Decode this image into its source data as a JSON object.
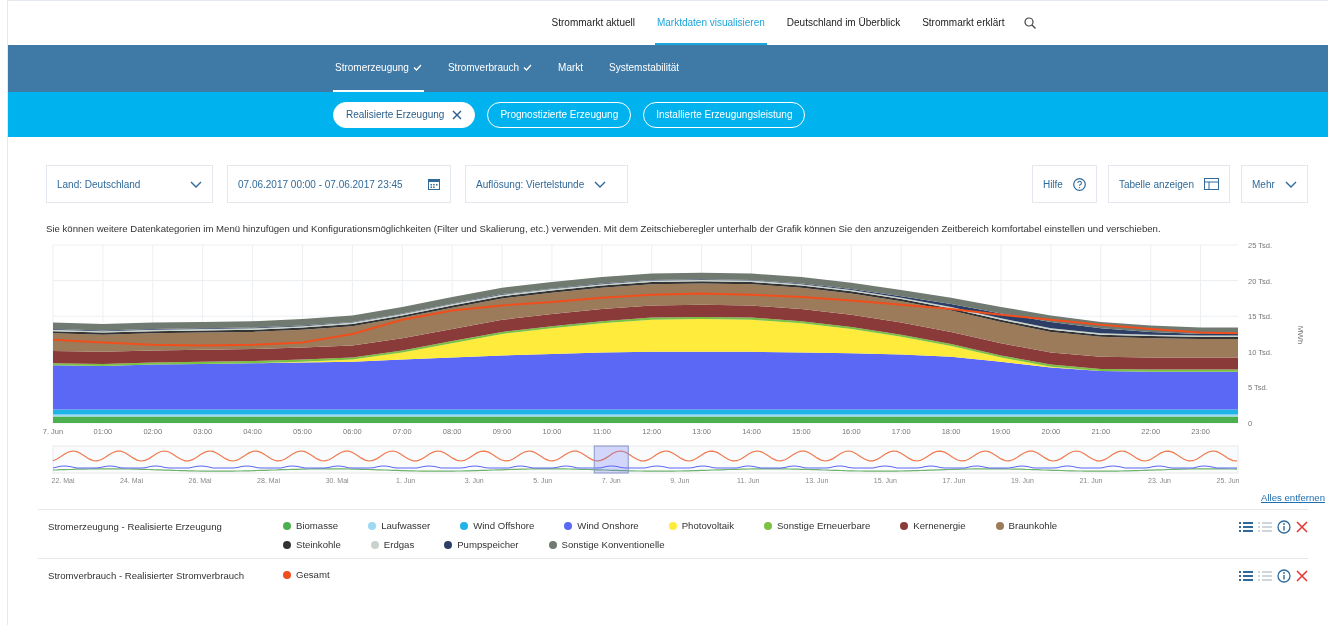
{
  "top_nav": {
    "items": [
      {
        "label": "Strommarkt aktuell",
        "selected": false
      },
      {
        "label": "Marktdaten visualisieren",
        "selected": true
      },
      {
        "label": "Deutschland im Überblick",
        "selected": false
      },
      {
        "label": "Strommarkt erklärt",
        "selected": false
      }
    ]
  },
  "sub_nav": {
    "items": [
      {
        "label": "Stromerzeugung",
        "selected": true,
        "checked": true
      },
      {
        "label": "Stromverbrauch",
        "selected": false,
        "checked": true
      },
      {
        "label": "Markt",
        "selected": false,
        "checked": false
      },
      {
        "label": "Systemstabilität",
        "selected": false,
        "checked": false
      }
    ]
  },
  "filters": [
    {
      "label": "Realisierte Erzeugung",
      "selected": true
    },
    {
      "label": "Prognostizierte Erzeugung",
      "selected": false
    },
    {
      "label": "Installierte Erzeugungsleistung",
      "selected": false
    }
  ],
  "controls": {
    "country": "Land: Deutschland",
    "date_range": "07.06.2017 00:00 - 07.06.2017 23:45",
    "resolution": "Auflösung: Viertelstunde",
    "help": "Hilfe",
    "table": "Tabelle anzeigen",
    "more": "Mehr"
  },
  "info_text": "Sie können weitere Datenkategorien im Menü hinzufügen und Konfigurationsmöglichkeiten (Filter und Skalierung, etc.) verwenden. Mit dem Zeitschieberegler unterhalb der Grafik können Sie den anzuzeigenden Zeitbereich komfortabel einstellen und verschieben.",
  "chart": {
    "chart_data": {
      "type": "area",
      "stacked": true,
      "ylabel": "MWh",
      "x": [
        0,
        1,
        2,
        3,
        4,
        5,
        6,
        7,
        8,
        9,
        10,
        11,
        12,
        13,
        14,
        15,
        16,
        17,
        18,
        19,
        20,
        21,
        22,
        23,
        23.75
      ],
      "xticks": [
        {
          "value": 0,
          "label": "7. Jun"
        },
        {
          "value": 1,
          "label": "01:00"
        },
        {
          "value": 2,
          "label": "02:00"
        },
        {
          "value": 3,
          "label": "03:00"
        },
        {
          "value": 4,
          "label": "04:00"
        },
        {
          "value": 5,
          "label": "05:00"
        },
        {
          "value": 6,
          "label": "06:00"
        },
        {
          "value": 7,
          "label": "07:00"
        },
        {
          "value": 8,
          "label": "08:00"
        },
        {
          "value": 9,
          "label": "09:00"
        },
        {
          "value": 10,
          "label": "10:00"
        },
        {
          "value": 11,
          "label": "11:00"
        },
        {
          "value": 12,
          "label": "12:00"
        },
        {
          "value": 13,
          "label": "13:00"
        },
        {
          "value": 14,
          "label": "14:00"
        },
        {
          "value": 15,
          "label": "15:00"
        },
        {
          "value": 16,
          "label": "16:00"
        },
        {
          "value": 17,
          "label": "17:00"
        },
        {
          "value": 18,
          "label": "18:00"
        },
        {
          "value": 19,
          "label": "19:00"
        },
        {
          "value": 20,
          "label": "20:00"
        },
        {
          "value": 21,
          "label": "21:00"
        },
        {
          "value": 22,
          "label": "22:00"
        },
        {
          "value": 23,
          "label": "23:00"
        }
      ],
      "grid": true,
      "xlim": [
        0,
        23.75
      ],
      "ylim": [
        0,
        25
      ],
      "yticks": [
        {
          "value": 0,
          "label": "0"
        },
        {
          "value": 5,
          "label": "5 Tsd."
        },
        {
          "value": 10,
          "label": "10 Tsd."
        },
        {
          "value": 15,
          "label": "15 Tsd."
        },
        {
          "value": 20,
          "label": "20 Tsd."
        },
        {
          "value": 25,
          "label": "25 Tsd."
        }
      ],
      "series": [
        {
          "name": "Biomasse",
          "color": "#4caf50",
          "values": [
            0.9,
            0.9,
            0.9,
            0.9,
            0.9,
            0.9,
            0.9,
            0.9,
            0.9,
            0.9,
            0.9,
            0.9,
            0.9,
            0.9,
            0.9,
            0.9,
            0.9,
            0.9,
            0.9,
            0.9,
            0.9,
            0.9,
            0.9,
            0.9,
            0.9
          ]
        },
        {
          "name": "Laufwasser",
          "color": "#9dd9f3",
          "values": [
            0.3,
            0.3,
            0.3,
            0.3,
            0.3,
            0.3,
            0.3,
            0.3,
            0.3,
            0.3,
            0.3,
            0.3,
            0.3,
            0.3,
            0.3,
            0.3,
            0.3,
            0.3,
            0.3,
            0.3,
            0.3,
            0.3,
            0.3,
            0.3,
            0.3
          ]
        },
        {
          "name": "Wind Offshore",
          "color": "#1fb4e6",
          "values": [
            0.7,
            0.7,
            0.7,
            0.7,
            0.7,
            0.7,
            0.7,
            0.7,
            0.7,
            0.7,
            0.7,
            0.7,
            0.7,
            0.7,
            0.7,
            0.7,
            0.7,
            0.7,
            0.7,
            0.7,
            0.7,
            0.7,
            0.7,
            0.7,
            0.7
          ]
        },
        {
          "name": "Wind Onshore",
          "color": "#5b67f5",
          "values": [
            6.2,
            6.1,
            6.3,
            6.4,
            6.5,
            6.6,
            6.7,
            7.0,
            7.3,
            7.6,
            7.8,
            8.0,
            8.1,
            8.1,
            8.1,
            8.0,
            7.9,
            7.7,
            7.4,
            6.7,
            5.9,
            5.4,
            5.3,
            5.3,
            5.3
          ]
        },
        {
          "name": "Photovoltaik",
          "color": "#ffeb3b",
          "values": [
            0,
            0,
            0,
            0,
            0,
            0.1,
            0.3,
            1.0,
            2.0,
            3.0,
            3.6,
            4.1,
            4.5,
            4.6,
            4.5,
            4.1,
            3.4,
            2.5,
            1.5,
            0.6,
            0.1,
            0,
            0,
            0,
            0
          ]
        },
        {
          "name": "Sonstige Erneuerbare",
          "color": "#7cc242",
          "values": [
            0.3,
            0.3,
            0.3,
            0.3,
            0.3,
            0.3,
            0.3,
            0.3,
            0.3,
            0.3,
            0.3,
            0.3,
            0.3,
            0.3,
            0.3,
            0.3,
            0.3,
            0.3,
            0.3,
            0.3,
            0.3,
            0.3,
            0.3,
            0.3,
            0.3
          ]
        },
        {
          "name": "Kernenergie",
          "color": "#8b3a3a",
          "values": [
            1.7,
            1.7,
            1.7,
            1.7,
            1.7,
            1.7,
            1.7,
            1.7,
            1.7,
            1.7,
            1.7,
            1.7,
            1.7,
            1.7,
            1.7,
            1.7,
            1.7,
            1.7,
            1.7,
            1.7,
            1.7,
            1.7,
            1.7,
            1.7,
            1.7
          ]
        },
        {
          "name": "Braunkohle",
          "color": "#9c7b5a",
          "values": [
            2.5,
            2.4,
            2.4,
            2.4,
            2.4,
            2.5,
            2.7,
            2.9,
            3.0,
            3.0,
            3.0,
            3.0,
            3.0,
            3.0,
            3.0,
            3.0,
            3.0,
            3.0,
            3.0,
            3.0,
            2.9,
            2.8,
            2.7,
            2.6,
            2.6
          ]
        },
        {
          "name": "Steinkohle",
          "color": "#333333",
          "values": [
            0.3,
            0.3,
            0.3,
            0.3,
            0.3,
            0.3,
            0.3,
            0.3,
            0.3,
            0.3,
            0.3,
            0.3,
            0.3,
            0.3,
            0.3,
            0.3,
            0.3,
            0.3,
            0.3,
            0.3,
            0.3,
            0.3,
            0.3,
            0.3,
            0.3
          ]
        },
        {
          "name": "Erdgas",
          "color": "#c9d3cc",
          "values": [
            0.2,
            0.2,
            0.2,
            0.2,
            0.2,
            0.2,
            0.2,
            0.2,
            0.2,
            0.2,
            0.2,
            0.2,
            0.2,
            0.2,
            0.2,
            0.2,
            0.2,
            0.2,
            0.2,
            0.2,
            0.2,
            0.2,
            0.2,
            0.2,
            0.2
          ]
        },
        {
          "name": "Pumpspeicher",
          "color": "#2c3e66",
          "values": [
            0.1,
            0.1,
            0.1,
            0.1,
            0.1,
            0.1,
            0.1,
            0.1,
            0.1,
            0.1,
            0.1,
            0.1,
            0.1,
            0.1,
            0.1,
            0.1,
            0.1,
            0.2,
            0.4,
            0.7,
            0.9,
            0.7,
            0.4,
            0.2,
            0.2
          ]
        },
        {
          "name": "Sonstige Konventionelle",
          "color": "#707a70",
          "values": [
            0.9,
            0.9,
            0.9,
            0.9,
            0.9,
            0.9,
            0.9,
            0.9,
            0.9,
            0.9,
            0.9,
            0.9,
            0.9,
            0.9,
            0.9,
            0.9,
            0.9,
            0.9,
            0.9,
            0.9,
            0.9,
            0.9,
            0.9,
            0.9,
            0.9
          ]
        },
        {
          "name": "Gesamt",
          "type": "line",
          "color": "#f04e1c",
          "values": [
            11.7,
            11.3,
            11.0,
            10.9,
            11.0,
            11.3,
            12.5,
            14.5,
            15.8,
            16.5,
            17.0,
            17.6,
            18.0,
            18.2,
            18.0,
            17.7,
            17.2,
            16.6,
            16.0,
            15.2,
            14.5,
            13.8,
            13.2,
            12.7,
            12.6
          ]
        }
      ]
    }
  },
  "navigator": {
    "labels": [
      "22. Mai",
      "24. Mai",
      "26. Mai",
      "28. Mai",
      "30. Mai",
      "1. Jun",
      "3. Jun",
      "5. Jun",
      "7. Jun",
      "9. Jun",
      "11. Jun",
      "13. Jun",
      "15. Jun",
      "17. Jun",
      "19. Jun",
      "21. Jun",
      "23. Jun",
      "25. Jun"
    ]
  },
  "remove_all": "Alles entfernen",
  "legend": [
    {
      "label": "Stromerzeugung - Realisierte Erzeugung",
      "actions": [
        {
          "kind": "list",
          "disabled": false
        },
        {
          "kind": "list",
          "disabled": true
        },
        {
          "kind": "info",
          "disabled": false
        },
        {
          "kind": "remove",
          "disabled": false
        }
      ]
    },
    {
      "label": "Stromverbrauch - Realisierter Stromverbrauch",
      "actions": [
        {
          "kind": "list",
          "disabled": false
        },
        {
          "kind": "list",
          "disabled": true
        },
        {
          "kind": "info",
          "disabled": false
        },
        {
          "kind": "remove",
          "disabled": false
        }
      ]
    }
  ]
}
